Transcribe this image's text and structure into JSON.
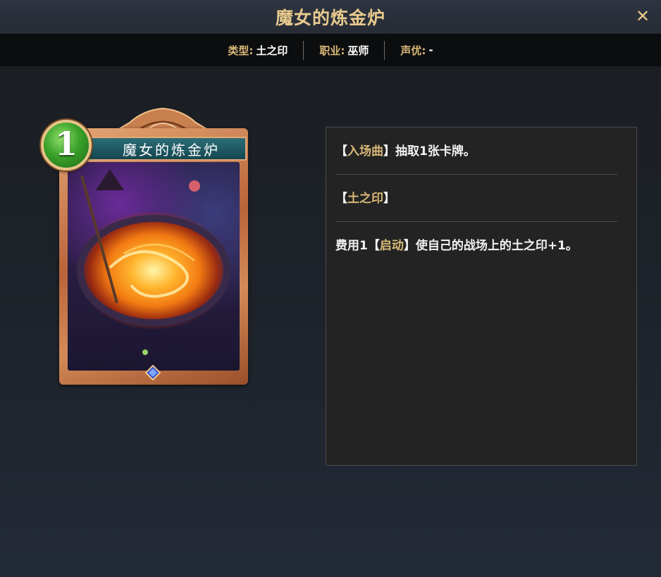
{
  "window": {
    "title": "魔女的炼金炉",
    "close_glyph": "✕"
  },
  "info": {
    "type_label": "类型:",
    "type_value": "土之印",
    "class_label": "职业:",
    "class_value": "巫师",
    "voice_label": "声优:",
    "voice_value": "-"
  },
  "card": {
    "cost": "1",
    "name": "魔女的炼金炉"
  },
  "effects": [
    {
      "kw": "入场曲",
      "pre": "",
      "text": "抽取1张卡牌。"
    },
    {
      "kw": "土之印",
      "pre": "",
      "text": ""
    },
    {
      "kw": "启动",
      "pre": "费用1",
      "text": "使自己的战场上的土之印+1。"
    }
  ],
  "colors": {
    "accent_gold": "#d9b877",
    "title_gold": "#e7c98d",
    "cost_gem_green": "#3aa12a"
  }
}
